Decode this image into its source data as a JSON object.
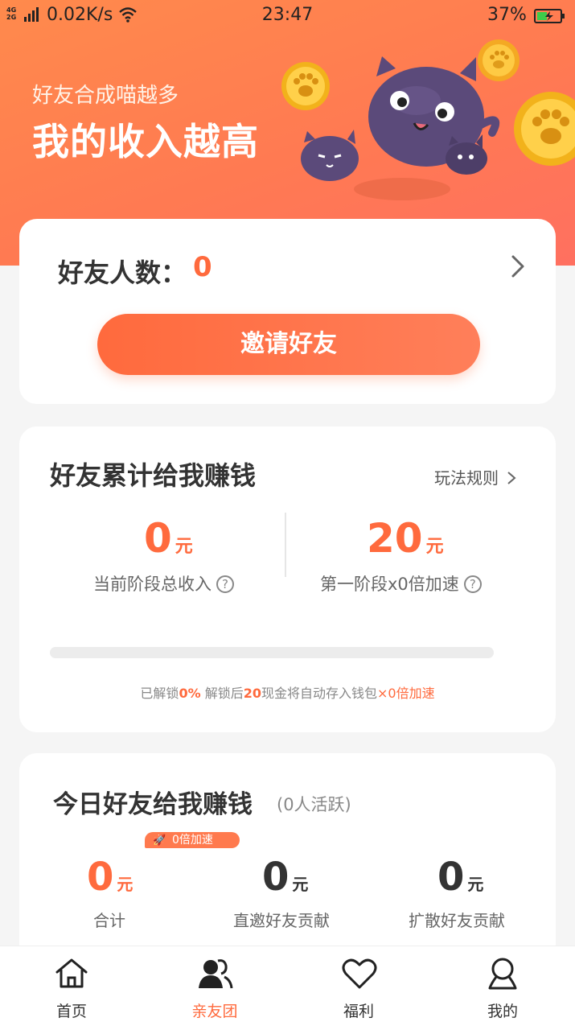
{
  "status_bar": {
    "net_top": "4G",
    "net_bottom": "2G",
    "speed": "0.02K/s",
    "time": "23:47",
    "battery": "37%"
  },
  "hero": {
    "subtitle": "好友合成喵越多",
    "title": "我的收入越高"
  },
  "friends_card": {
    "label": "好友人数：",
    "count": "0",
    "invite_button": "邀请好友"
  },
  "cumulative_card": {
    "title": "好友累计给我赚钱",
    "rules_link": "玩法规则",
    "current_value": "0",
    "current_unit": "元",
    "current_label": "当前阶段总收入",
    "stage_value": "20",
    "stage_unit": "元",
    "stage_label": "第一阶段x0倍加速",
    "progress_percent": 0,
    "unlock_prefix": "已解锁",
    "unlock_percent": "0%",
    "unlock_mid": " 解锁后",
    "unlock_amount": "20",
    "unlock_suffix": "现金将自动存入钱包",
    "unlock_speed": "×0倍加速"
  },
  "today_card": {
    "title": "今日好友给我赚钱",
    "active": "(0人活跃)",
    "speed_badge": "0倍加速",
    "total_value": "0",
    "total_unit": "元",
    "total_label": "合计",
    "direct_value": "0",
    "direct_unit": "元",
    "direct_label": "直邀好友贡献",
    "spread_value": "0",
    "spread_unit": "元",
    "spread_label": "扩散好友贡献"
  },
  "tabbar": {
    "items": [
      {
        "label": "首页",
        "icon": "home-icon"
      },
      {
        "label": "亲友团",
        "icon": "friends-group-icon",
        "active": true
      },
      {
        "label": "福利",
        "icon": "heart-icon"
      },
      {
        "label": "我的",
        "icon": "profile-icon"
      }
    ]
  },
  "colors": {
    "accent": "#ff6a3d",
    "hero_start": "#ff8a4c",
    "hero_end": "#ff7060"
  }
}
